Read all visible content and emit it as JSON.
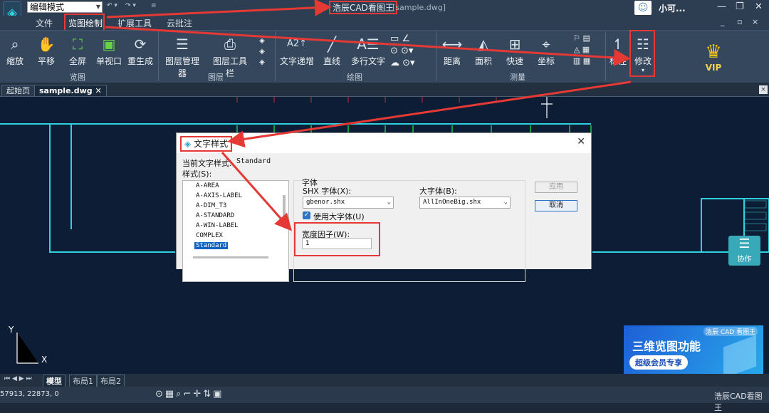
{
  "titlebar": {
    "mode": "编辑模式",
    "app_title": "浩辰CAD看图王",
    "file": "[sample.dwg]",
    "user": "小可...",
    "min": "—",
    "restore": "❐",
    "close": "✕"
  },
  "menubar": {
    "items": [
      "文件",
      "览图绘制",
      "扩展工具",
      "云批注"
    ],
    "sub_min": "_",
    "sub_restore": "▫",
    "sub_close": "×"
  },
  "ribbon": {
    "browse": [
      "缩放",
      "平移",
      "全屏",
      "单视口",
      "重生成"
    ],
    "layer": [
      "图层管理器",
      "图层工具栏"
    ],
    "draw": [
      "文字递增",
      "直线",
      "多行文字"
    ],
    "measure": [
      "距离",
      "面积",
      "快速",
      "坐标"
    ],
    "mark": [
      "标注",
      "修改"
    ],
    "groups": [
      "览图",
      "图层",
      "绘图",
      "测量"
    ],
    "vip": "VIP"
  },
  "tabs": [
    "起始页",
    "sample.dwg"
  ],
  "layout": [
    "模型",
    "布局1",
    "布局2"
  ],
  "status": {
    "coords": "57913, 22873, 0",
    "brand": "浩辰CAD看图王"
  },
  "collab": "协作",
  "ad": {
    "brand": "浩辰 CAD 看图王",
    "title": "三维览图功能",
    "subtitle": "超级会员专享"
  },
  "axis": {
    "y": "Y",
    "x": "X"
  },
  "dialog": {
    "title": "文字样式",
    "current_label": "当前文字样式:",
    "current_value": "Standard",
    "styles_label": "样式(S):",
    "styles": [
      "A-AREA",
      "A-AXIS-LABEL",
      "A-DIM_T3",
      "A-STANDARD",
      "A-WIN-LABEL",
      "COMPLEX",
      "Standard"
    ],
    "font_group": "字体",
    "shx_label": "SHX 字体(X):",
    "shx_value": "gbenor.shx",
    "big_label": "大字体(B):",
    "big_value": "AllInOneBig.shx",
    "use_big": "使用大字体(U)",
    "width_label": "宽度因子(W):",
    "width_value": "1",
    "apply": "应用",
    "cancel": "取消"
  },
  "colors": {
    "accent_red": "#e53935",
    "cad_bg": "#0d1d35",
    "cyan": "#2fd1df"
  }
}
